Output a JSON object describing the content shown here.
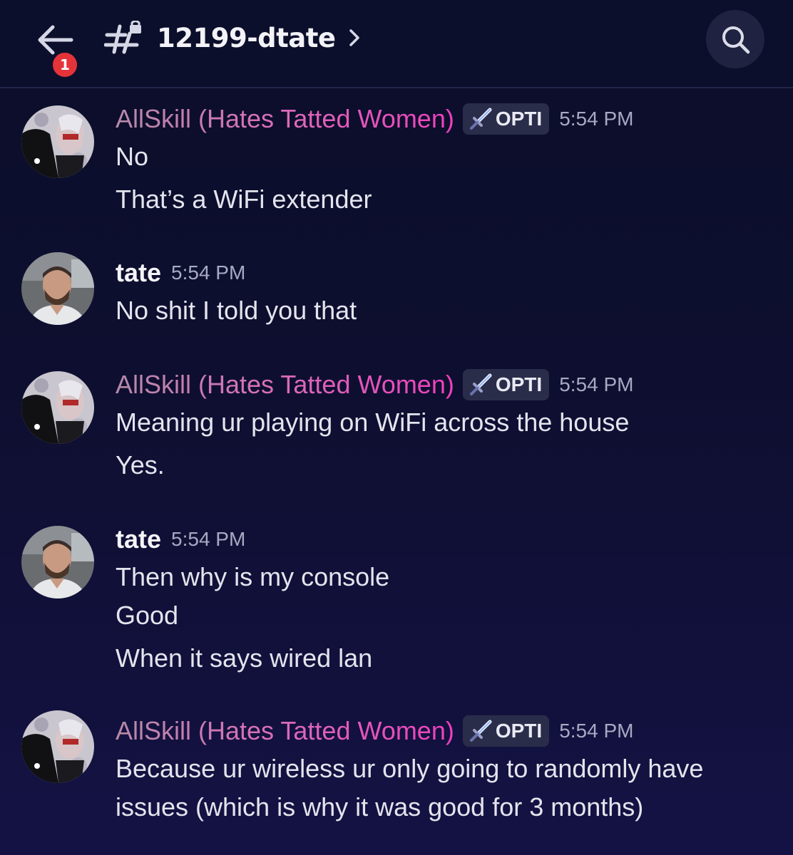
{
  "header": {
    "back_badge": "1",
    "channel_name": "12199-dtate",
    "icons": {
      "back": "arrow-left-icon",
      "channel": "hashtag-lock-icon",
      "chevron": "chevron-right-icon",
      "search": "search-icon"
    }
  },
  "messages": [
    {
      "author": "AllSkill (Hates Tatted Women)",
      "role": "OPTI",
      "role_icon": "sword-icon",
      "time": "5:54 PM",
      "lines": [
        "No",
        "That’s a WiFi extender"
      ]
    },
    {
      "author": "tate",
      "time": "5:54 PM",
      "lines": [
        "No shit I told you that"
      ]
    },
    {
      "author": "AllSkill (Hates Tatted Women)",
      "role": "OPTI",
      "role_icon": "sword-icon",
      "time": "5:54 PM",
      "lines": [
        "Meaning ur playing on WiFi across the house",
        "Yes."
      ]
    },
    {
      "author": "tate",
      "time": "5:54 PM",
      "lines": [
        "Then why is my console",
        "Good",
        "When it says wired lan"
      ]
    },
    {
      "author": "AllSkill (Hates Tatted Women)",
      "role": "OPTI",
      "role_icon": "sword-icon",
      "time": "5:54 PM",
      "lines": [
        "Because ur wireless ur only going to randomly have",
        "issues (which is why it was good for 3 months)"
      ]
    }
  ],
  "colors": {
    "background": "#0e0f30",
    "header": "#0c0f2b",
    "badge": "#e5333a",
    "allskill_name_start": "#b58aa8",
    "allskill_name_end": "#ef3fbe",
    "role_tag_bg": "#2a2d4a",
    "timestamp": "#a8a9c2"
  }
}
